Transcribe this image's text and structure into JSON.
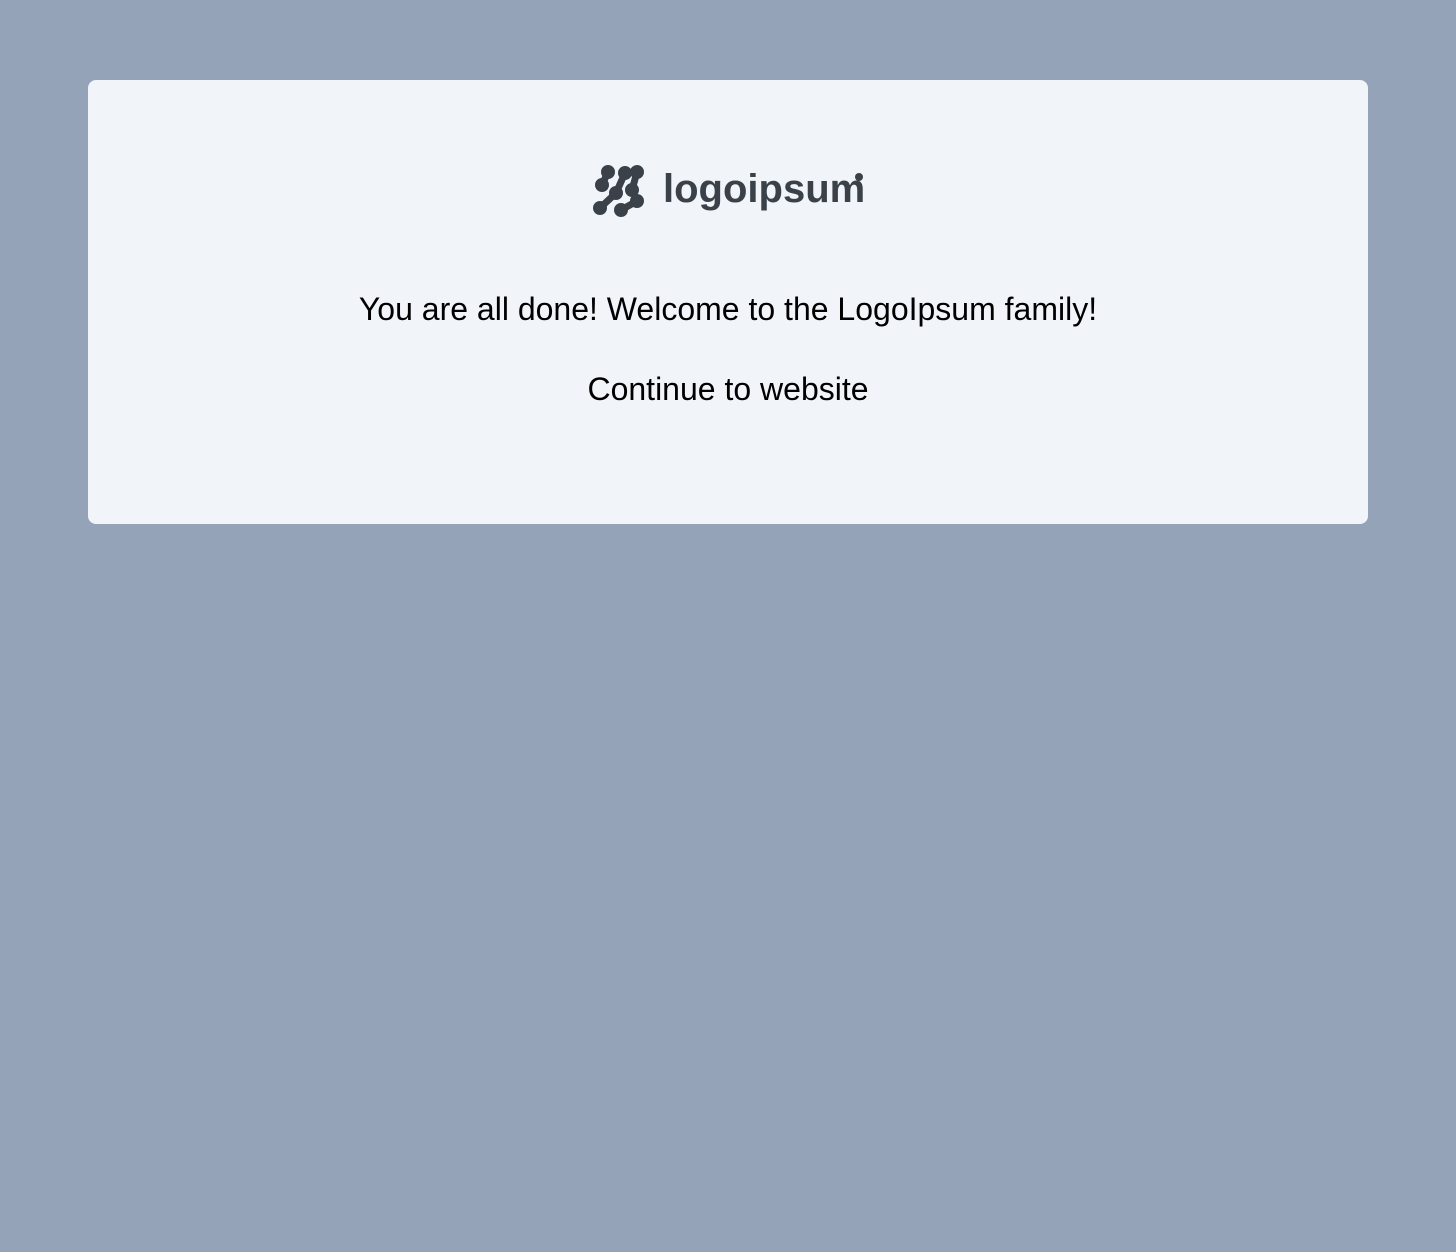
{
  "logo": {
    "wordmark": "logoipsum",
    "icon": "logo-mark-icon",
    "color": "#3a4149"
  },
  "message": {
    "text": "You are all done! Welcome to the LogoIpsum family!"
  },
  "actions": {
    "continue_label": "Continue to website"
  },
  "colors": {
    "page_background": "#94a3b8",
    "card_background": "#f1f5f9",
    "text": "#000000"
  }
}
